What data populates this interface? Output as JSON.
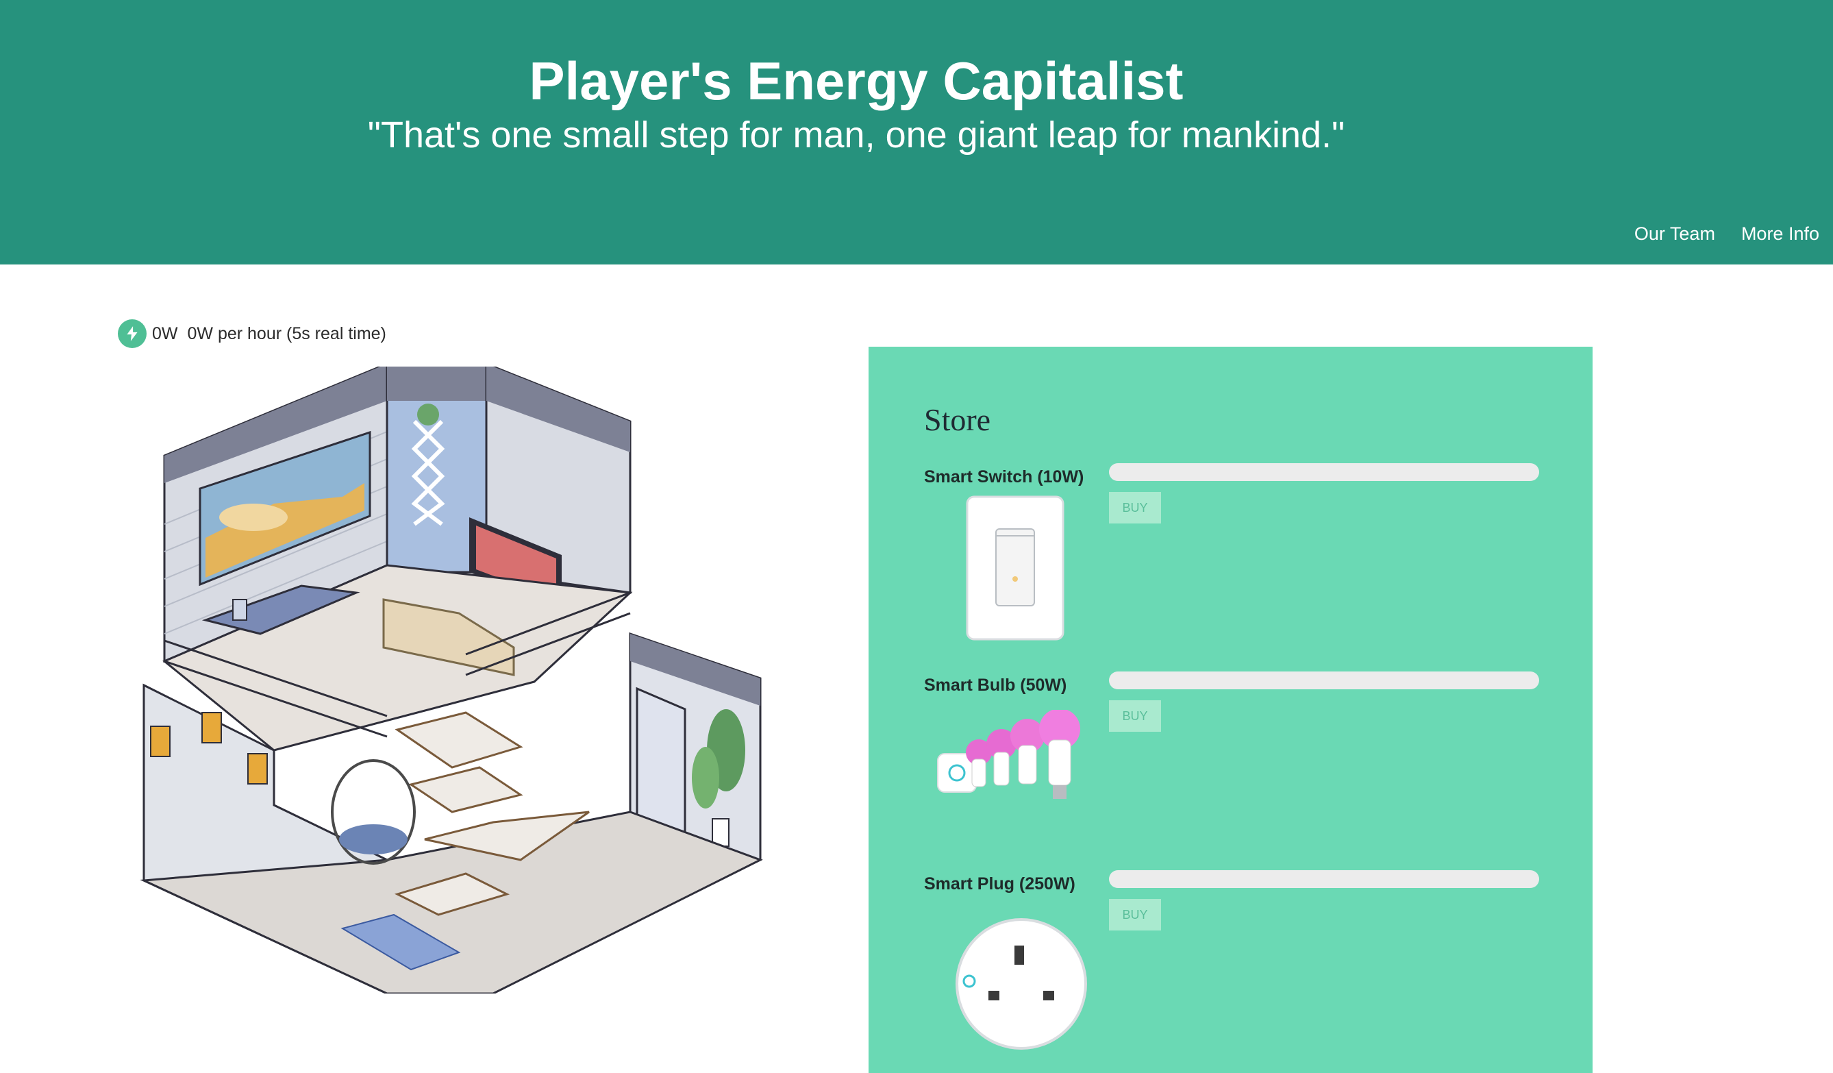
{
  "header": {
    "title": "Player's Energy Capitalist",
    "quote": "\"That's one small step for man, one giant leap for mankind.\"",
    "nav": [
      {
        "label": "Our Team"
      },
      {
        "label": "More Info"
      }
    ],
    "color": "#26927d"
  },
  "energy": {
    "icon": "lightning-bolt-icon",
    "total": "0W",
    "rate": "0W per hour (5s real time)"
  },
  "store": {
    "title": "Store",
    "background": "#6ad9b4",
    "items": [
      {
        "name": "Smart Switch (10W)",
        "buy_label": "BUY",
        "progress": 0,
        "image": "smart-switch-image"
      },
      {
        "name": "Smart Bulb (50W)",
        "buy_label": "BUY",
        "progress": 0,
        "image": "smart-bulb-image"
      },
      {
        "name": "Smart Plug (250W)",
        "buy_label": "BUY",
        "progress": 0,
        "image": "smart-plug-image"
      }
    ]
  }
}
